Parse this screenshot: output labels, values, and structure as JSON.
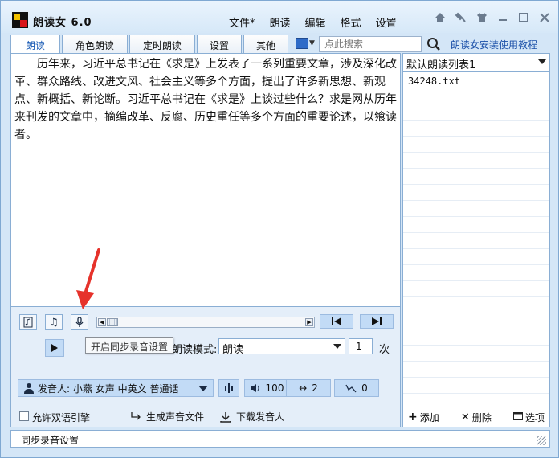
{
  "app": {
    "title": "朗读女 6.0",
    "colors": {
      "accent": "#1a5bb5",
      "panel": "#c2dbf6",
      "border": "#8aaed4"
    }
  },
  "menu": {
    "items": [
      "文件*",
      "朗读",
      "编辑",
      "格式",
      "设置"
    ]
  },
  "window_controls": [
    "home-icon",
    "pin-icon",
    "shirt-icon",
    "minimize-icon",
    "maximize-icon",
    "close-icon"
  ],
  "tabs": [
    {
      "label": "朗读",
      "active": true
    },
    {
      "label": "角色朗读",
      "active": false
    },
    {
      "label": "定时朗读",
      "active": false
    },
    {
      "label": "设置",
      "active": false
    },
    {
      "label": "其他",
      "active": false
    }
  ],
  "search": {
    "placeholder": "点此搜索"
  },
  "tutorial_link": "朗读女安装使用教程",
  "editor": {
    "text": "历年来，习近平总书记在《求是》上发表了一系列重要文章，涉及深化改革、群众路线、改进文风、社会主义等多个方面，提出了许多新思想、新观点、新概括、新论断。习近平总书记在《求是》上谈过些什么？求是网从历年来刊发的文章中，摘编改革、反腐、历史重任等多个方面的重要论述，以飨读者。"
  },
  "playlist": {
    "selected": "默认朗读列表1",
    "files": [
      "34248.txt"
    ],
    "actions": {
      "add": "添加",
      "delete": "删除",
      "options": "选项"
    }
  },
  "controls": {
    "tooltip": "开启同步录音设置",
    "mode_label": "朗读模式:",
    "mode_value": "朗读",
    "times_value": "1",
    "times_label": "次",
    "voice_label": "发音人:",
    "voice_value": "小燕 女声 中英文 普通话",
    "volume": "100",
    "speed": "2",
    "pitch": "0",
    "dual_engine_label": "允许双语引擎",
    "generate_label": "生成声音文件",
    "download_label": "下载发音人"
  },
  "status": {
    "text": "同步录音设置"
  }
}
